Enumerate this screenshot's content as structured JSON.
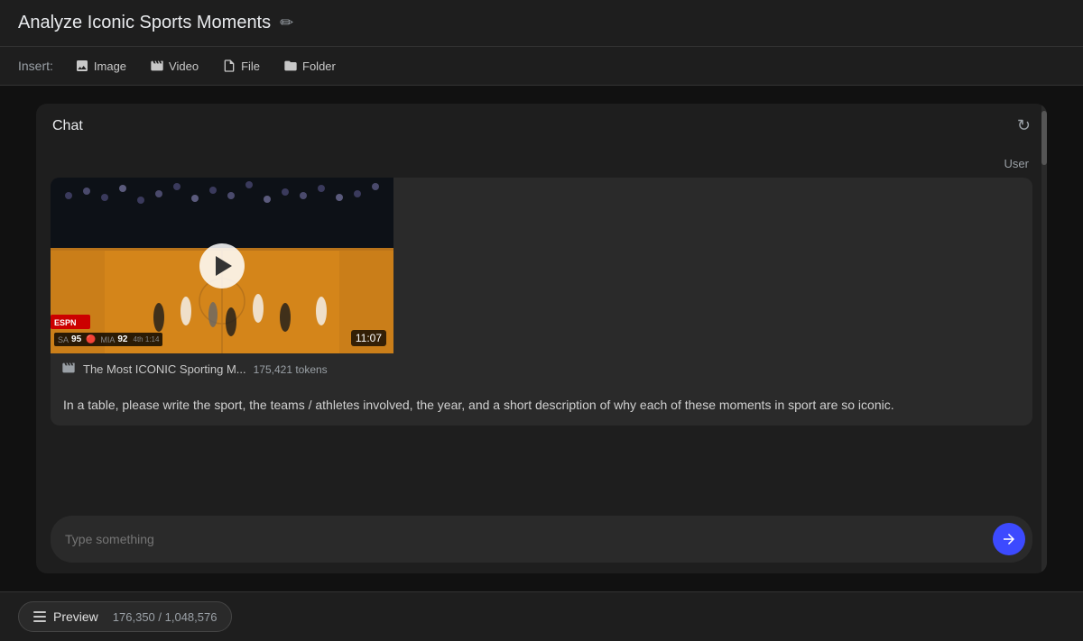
{
  "header": {
    "title": "Analyze Iconic Sports Moments",
    "edit_icon": "✏"
  },
  "toolbar": {
    "label": "Insert:",
    "buttons": [
      {
        "id": "image",
        "label": "Image",
        "icon": "image"
      },
      {
        "id": "video",
        "label": "Video",
        "icon": "video"
      },
      {
        "id": "file",
        "label": "File",
        "icon": "file"
      },
      {
        "id": "folder",
        "label": "Folder",
        "icon": "folder"
      }
    ]
  },
  "chat": {
    "title": "Chat",
    "user_label": "User",
    "video": {
      "name": "The Most ICONIC Sporting M...",
      "tokens": "175,421 tokens",
      "duration": "11:07"
    },
    "message_text": "In a table, please write the sport, the teams / athletes involved, the year, and a short description of why each of these moments in sport are so iconic.",
    "input_placeholder": "Type something"
  },
  "footer": {
    "preview_label": "Preview",
    "token_info": "176,350 / 1,048,576"
  }
}
